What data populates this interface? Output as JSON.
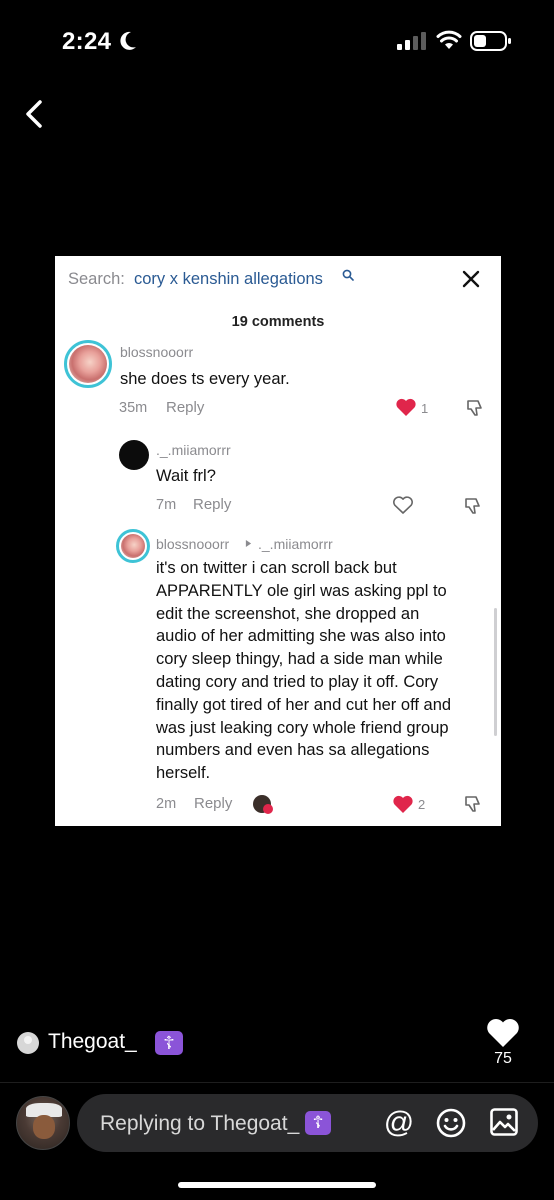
{
  "status_bar": {
    "time": "2:24",
    "icons": [
      "moon-icon",
      "signal-icon",
      "wifi-icon",
      "battery-icon"
    ]
  },
  "nav": {
    "back_icon": "chevron-left-icon"
  },
  "screenshot_card": {
    "search_prefix": "Search:",
    "search_query": "cory x kenshin allegations",
    "search_icon": "search-icon",
    "close_icon": "close-icon",
    "comments_count": "19 comments",
    "comments": [
      {
        "username": "blossnooorr",
        "text": "she does ts every year.",
        "time": "35m",
        "reply_label": "Reply",
        "likes": "1",
        "liked": true
      },
      {
        "username": "._.miiamorrr",
        "text": "Wait frl?",
        "time": "7m",
        "reply_label": "Reply",
        "liked": false
      },
      {
        "username": "blossnooorr",
        "reply_to": "._.miiamorrr",
        "text_lines": [
          "it's on twitter i can scroll back but",
          "APPARENTLY ole girl was asking ppl to",
          "edit the screenshot, she dropped an",
          "audio of her admitting she was also into",
          "cory sleep thingy, had a side man while",
          "dating cory and tried to play it off. Cory",
          "finally got tired of her and cut her off and",
          "was just leaking cory whole friend group",
          "numbers and even has sa allegations",
          "herself."
        ],
        "time": "2m",
        "reply_label": "Reply",
        "likes": "2",
        "liked": true
      }
    ],
    "colors": {
      "link": "#2a5a93",
      "liked_heart": "#e0264b",
      "avatar_ring": "#3ec3d6"
    }
  },
  "comment_overlay": {
    "commenter_name": "Thegoat_",
    "commenter_emoji": "☦",
    "like_icon": "heart-icon",
    "like_count": "75"
  },
  "reply_bar": {
    "placeholder_prefix": "Replying to Thegoat_",
    "placeholder_emoji": "☦",
    "mention_symbol": "@",
    "emoji_icon": "emoji-icon",
    "image_icon": "image-icon",
    "accent": "#8b54d8"
  }
}
